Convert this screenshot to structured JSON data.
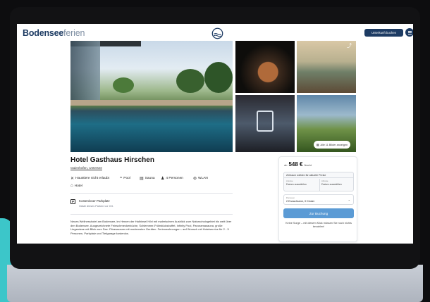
{
  "header": {
    "logo_part1": "Bodensee",
    "logo_part2": "ferien",
    "book_button": "Unterkunft buchen"
  },
  "gallery": {
    "show_all_label": "Alle 11 Bilder anzeigen"
  },
  "hotel": {
    "name": "Hotel Gasthaus Hirschen",
    "location": "Gaienhofen, Untersee",
    "features": [
      {
        "icon": "no-pets-icon",
        "label": "Haustiere nicht erlaubt"
      },
      {
        "icon": "pool-icon",
        "label": "Pool"
      },
      {
        "icon": "sauna-icon",
        "label": "Sauna"
      },
      {
        "icon": "persons-icon",
        "label": "4 Personen"
      },
      {
        "icon": "wifi-icon",
        "label": "WLAN"
      },
      {
        "icon": "hotel-icon",
        "label": "Hotel"
      }
    ],
    "parking_title": "Kostenloser Parkplatz",
    "parking_sub": "Gäste dieses Parken vor Ort.",
    "description": "Neues Wellnesshotel am Bodensee, im Herzen der Halbinsel Höri mit malerischem Ausblick zum Naturschutzgebiet bis weit über den Bodensee. Ausgezeichnete Feinschmeckerküche, Schlemmer-Frühstücksbuffet, Infinity Pool, Panoramasauna, große Liegewiese mit Blick zum See. Fitnessraum mit modernsten Geräten. Ferienwohnungen - auf Wunsch mit Hotelservice für 2 - 5 Personen, Parkplatz und Tiefgarage kostenlos."
  },
  "booking": {
    "price_prefix": "ab",
    "price": "548 €",
    "price_unit": "Nacht",
    "date_header": "Zeitraum wählen für aktuelle Preise",
    "arrival_label": "Anreise",
    "arrival_value": "Datum auswählen",
    "departure_label": "Abreise",
    "departure_value": "Datum auswählen",
    "guests_label": "Personen",
    "guests_value": "2 Erwachsene, 0 Kinder",
    "button": "Zur Buchung",
    "note": "Keine Sorge – mit diesem Klick müssen Sie noch nichts bezahlen!"
  },
  "colors": {
    "brand": "#1d3b63",
    "accent_button": "#5b9bd5",
    "backdrop_teal": "#3cc6c9"
  }
}
